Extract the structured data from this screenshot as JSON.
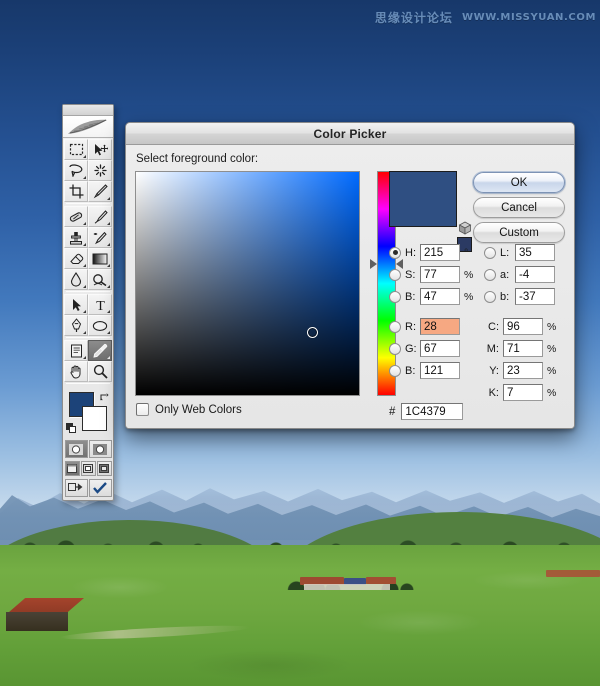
{
  "watermark": {
    "cn": "思缘设计论坛",
    "url": "WWW.MISSYUAN.COM"
  },
  "dialog": {
    "title": "Color Picker",
    "prompt": "Select foreground color:",
    "buttons": {
      "ok": "OK",
      "cancel": "Cancel",
      "custom": "Custom"
    },
    "web_colors_label": "Only Web Colors",
    "hex_symbol": "#",
    "hex_value": "1C4379",
    "current_color": "#1C4379",
    "preview_color": "#2F4F82",
    "alt_color": "#2B3A63",
    "selected_channel": "H",
    "hsb": [
      {
        "radio": "H",
        "label": "H:",
        "value": "215",
        "unit": "°",
        "selected": true
      },
      {
        "radio": "S",
        "label": "S:",
        "value": "77",
        "unit": "%",
        "selected": false
      },
      {
        "radio": "B",
        "label": "B:",
        "value": "47",
        "unit": "%",
        "selected": false
      }
    ],
    "rgb": [
      {
        "radio": "R",
        "label": "R:",
        "value": "28",
        "unit": "",
        "selected": false,
        "highlighted": true
      },
      {
        "radio": "G",
        "label": "G:",
        "value": "67",
        "unit": "",
        "selected": false,
        "highlighted": false
      },
      {
        "radio": "B",
        "label": "B:",
        "value": "121",
        "unit": "",
        "selected": false,
        "highlighted": false
      }
    ],
    "lab": [
      {
        "radio": "L",
        "label": "L:",
        "value": "35",
        "unit": "",
        "selected": false
      },
      {
        "radio": "a",
        "label": "a:",
        "value": "-4",
        "unit": "",
        "selected": false
      },
      {
        "radio": "b",
        "label": "b:",
        "value": "-37",
        "unit": "",
        "selected": false
      }
    ],
    "cmyk": [
      {
        "label": "C:",
        "value": "96",
        "unit": "%"
      },
      {
        "label": "M:",
        "value": "71",
        "unit": "%"
      },
      {
        "label": "Y:",
        "value": "23",
        "unit": "%"
      },
      {
        "label": "K:",
        "value": "7",
        "unit": "%"
      }
    ]
  },
  "toolbox": {
    "foreground_color": "#1C4379",
    "background_color": "#FFFFFF",
    "selected_tool": "eyedropper",
    "tools": [
      {
        "name": "marquee-tool",
        "has_flyout": true
      },
      {
        "name": "move-tool",
        "has_flyout": false
      },
      {
        "name": "lasso-tool",
        "has_flyout": true
      },
      {
        "name": "magic-wand-tool",
        "has_flyout": false
      },
      {
        "name": "crop-tool",
        "has_flyout": false
      },
      {
        "name": "slice-tool",
        "has_flyout": true
      },
      {
        "name": "healing-brush-tool",
        "has_flyout": true
      },
      {
        "name": "brush-tool",
        "has_flyout": true
      },
      {
        "name": "clone-stamp-tool",
        "has_flyout": true
      },
      {
        "name": "history-brush-tool",
        "has_flyout": true
      },
      {
        "name": "eraser-tool",
        "has_flyout": true
      },
      {
        "name": "gradient-tool",
        "has_flyout": true
      },
      {
        "name": "blur-tool",
        "has_flyout": true
      },
      {
        "name": "dodge-tool",
        "has_flyout": true
      },
      {
        "name": "path-selection-tool",
        "has_flyout": true
      },
      {
        "name": "type-tool",
        "has_flyout": true
      },
      {
        "name": "pen-tool",
        "has_flyout": true
      },
      {
        "name": "shape-tool",
        "has_flyout": true
      },
      {
        "name": "notes-tool",
        "has_flyout": true
      },
      {
        "name": "eyedropper-tool",
        "has_flyout": true
      },
      {
        "name": "hand-tool",
        "has_flyout": false
      },
      {
        "name": "zoom-tool",
        "has_flyout": false
      }
    ]
  }
}
